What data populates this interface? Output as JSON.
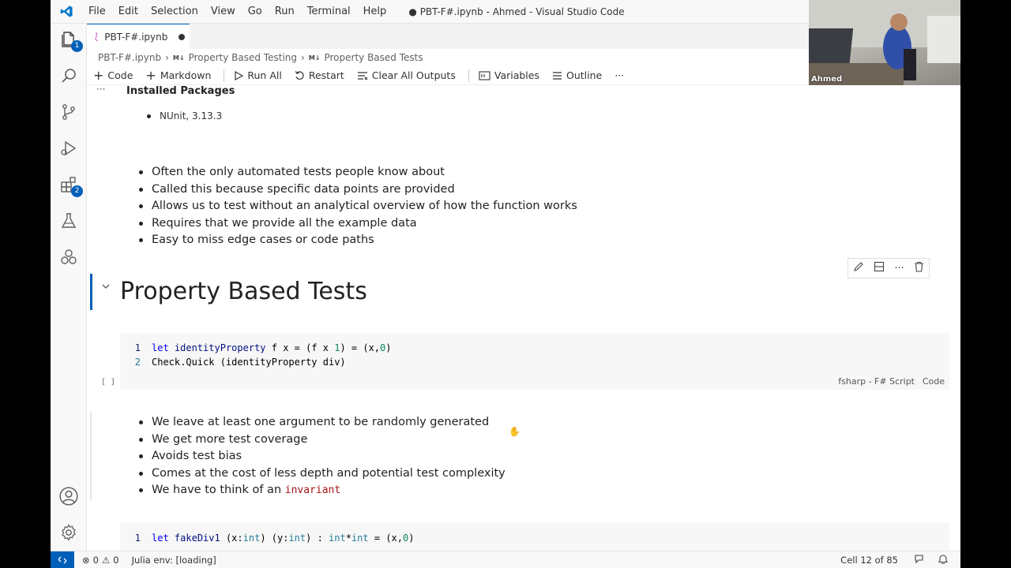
{
  "menu": [
    "File",
    "Edit",
    "Selection",
    "View",
    "Go",
    "Run",
    "Terminal",
    "Help"
  ],
  "window_title": "● PBT-F#.ipynb - Ahmed - Visual Studio Code",
  "activity_badges": {
    "explorer": "1",
    "extensions": "2"
  },
  "tab": {
    "label": "PBT-F#.ipynb"
  },
  "breadcrumb": [
    "PBT-F#.ipynb",
    "Property Based Testing",
    "Property Based Tests"
  ],
  "breadcrumb_md": "M↓",
  "toolbar": {
    "code": "Code",
    "markdown": "Markdown",
    "run_all": "Run All",
    "restart": "Restart",
    "clear_outputs": "Clear All Outputs",
    "variables": "Variables",
    "outline": "Outline",
    "more": "···"
  },
  "cells": {
    "output_more": "···",
    "installed_title": "Installed Packages",
    "installed_items": [
      "NUnit, 3.13.3"
    ],
    "example_bullets": [
      "Often the only automated tests people know about",
      "Called this because specific data points are provided",
      "Allows us to test without an analytical overview of how the function works",
      "Requires that we provide all the example data",
      "Easy to miss edge cases or code paths"
    ],
    "heading": "Property Based Tests",
    "code1_line1_num": "1",
    "code1_line2_num": "2",
    "code1_line2": "Check.Quick (identityProperty div)",
    "code1_exec": "[ ]",
    "code1_lang": "fsharp - F# Script",
    "code1_type": "Code",
    "prop_bullets": [
      "We leave at least one argument to be randomly generated",
      "We get more test coverage",
      "Avoids test bias",
      "Comes at the cost of less depth and potential test complexity"
    ],
    "prop_bullet_last_prefix": "We have to think of an ",
    "prop_bullet_last_code": "invariant",
    "code2_line1_num": "1"
  },
  "status": {
    "errors": "0",
    "warnings": "0",
    "julia": "Julia env: [loading]",
    "cell": "Cell 12 of 85"
  },
  "webcam": {
    "name": "Ahmed"
  },
  "colors": {
    "accent": "#005fb8",
    "keyword": "#0000ff",
    "string_code": "#a31515"
  }
}
